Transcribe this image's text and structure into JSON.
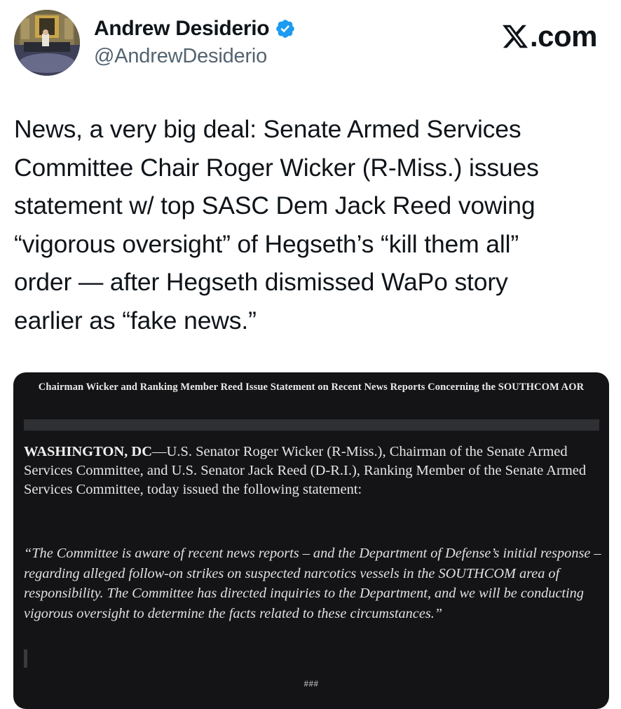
{
  "author": {
    "display_name": "Andrew Desiderio",
    "handle": "@AndrewDesiderio",
    "verified": true,
    "verified_color": "#1d9bf0"
  },
  "brand": {
    "x_glyph": "𝕏",
    "text": ".com"
  },
  "tweet": {
    "text": "News, a very big deal: Senate Armed Services\nCommittee Chair Roger Wicker (R-Miss.) issues\nstatement w/ top SASC Dem Jack Reed vowing\n“vigorous oversight” of Hegseth’s “kill them all”\norder — after Hegseth dismissed WaPo story\nearlier as “fake news.”"
  },
  "media": {
    "title": "Chairman Wicker and Ranking Member Reed Issue Statement on Recent News Reports Concerning the SOUTHCOM AOR",
    "dateline": "WASHINGTON, DC",
    "dateline_dash": "—",
    "paragraph": "U.S. Senator Roger Wicker (R-Miss.), Chairman of the Senate Armed Services Committee, and U.S. Senator Jack Reed (D-R.I.), Ranking Member of the Senate Armed Services Committee, today issued the following statement:",
    "quote": "“The Committee is aware of recent news reports – and the Department of Defense’s initial response – regarding alleged follow-on strikes on suspected narcotics vessels in the SOUTHCOM area of responsibility. The Committee has directed inquiries to the Department, and we will be conducting vigorous oversight to determine the facts related to these circumstances.”",
    "end_mark": "###",
    "background_color": "#141416"
  }
}
